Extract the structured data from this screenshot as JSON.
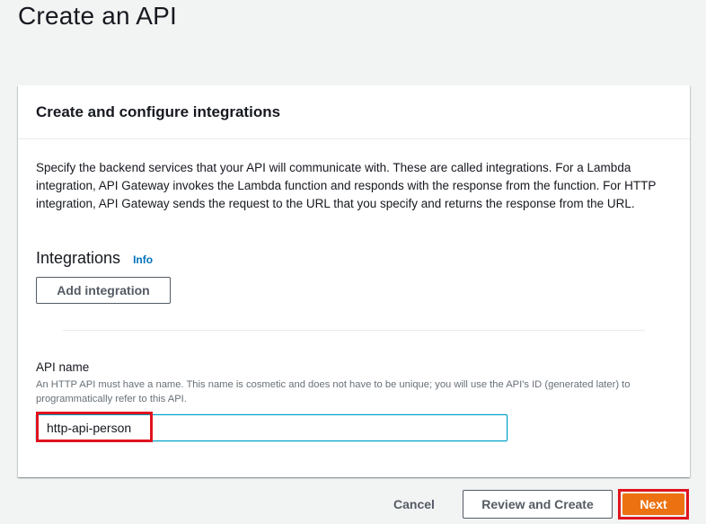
{
  "page": {
    "title": "Create an API"
  },
  "panel": {
    "title": "Create and configure integrations",
    "description": "Specify the backend services that your API will communicate with. These are called integrations. For a Lambda integration, API Gateway invokes the Lambda function and responds with the response from the function. For HTTP integration, API Gateway sends the request to the URL that you specify and returns the response from the URL."
  },
  "integrations": {
    "heading": "Integrations",
    "info_label": "Info",
    "add_button_label": "Add integration"
  },
  "api_name": {
    "label": "API name",
    "description": "An HTTP API must have a name. This name is cosmetic and does not have to be unique; you will use the API's ID (generated later) to programmatically refer to this API.",
    "value": "http-api-person"
  },
  "footer": {
    "cancel_label": "Cancel",
    "review_label": "Review and Create",
    "next_label": "Next"
  },
  "colors": {
    "primary_button": "#ec7211",
    "link": "#0073bb",
    "focus_border": "#00a1c9",
    "highlight_annotation": "#e0141e",
    "background": "#f2f3f3"
  }
}
